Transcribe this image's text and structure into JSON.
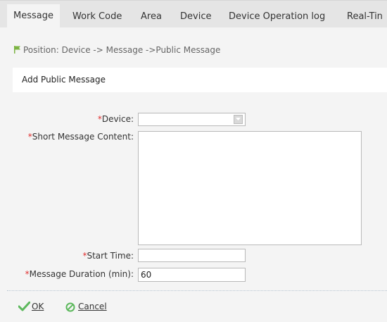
{
  "tabs": [
    {
      "label": "Message",
      "active": true
    },
    {
      "label": "Work Code"
    },
    {
      "label": "Area"
    },
    {
      "label": "Device"
    },
    {
      "label": "Device Operation log"
    },
    {
      "label": "Real-Tin"
    }
  ],
  "position": {
    "text": "Position: Device -> Message ->Public Message",
    "flag_color": "#7cb342"
  },
  "panel": {
    "title": "Add Public Message"
  },
  "form": {
    "device": {
      "required_mark": "*",
      "label": "Device:",
      "value": ""
    },
    "content": {
      "required_mark": "*",
      "label": "Short Message Content:",
      "value": ""
    },
    "start_time": {
      "required_mark": "*",
      "label": "Start Time:",
      "value": ""
    },
    "duration": {
      "required_mark": "*",
      "label": "Message Duration (min):",
      "value": "60"
    }
  },
  "actions": {
    "ok": {
      "label": "OK",
      "icon": "check-icon",
      "color": "#5cb85c"
    },
    "cancel": {
      "label": "Cancel",
      "icon": "cancel-icon",
      "color": "#5cb85c"
    }
  }
}
